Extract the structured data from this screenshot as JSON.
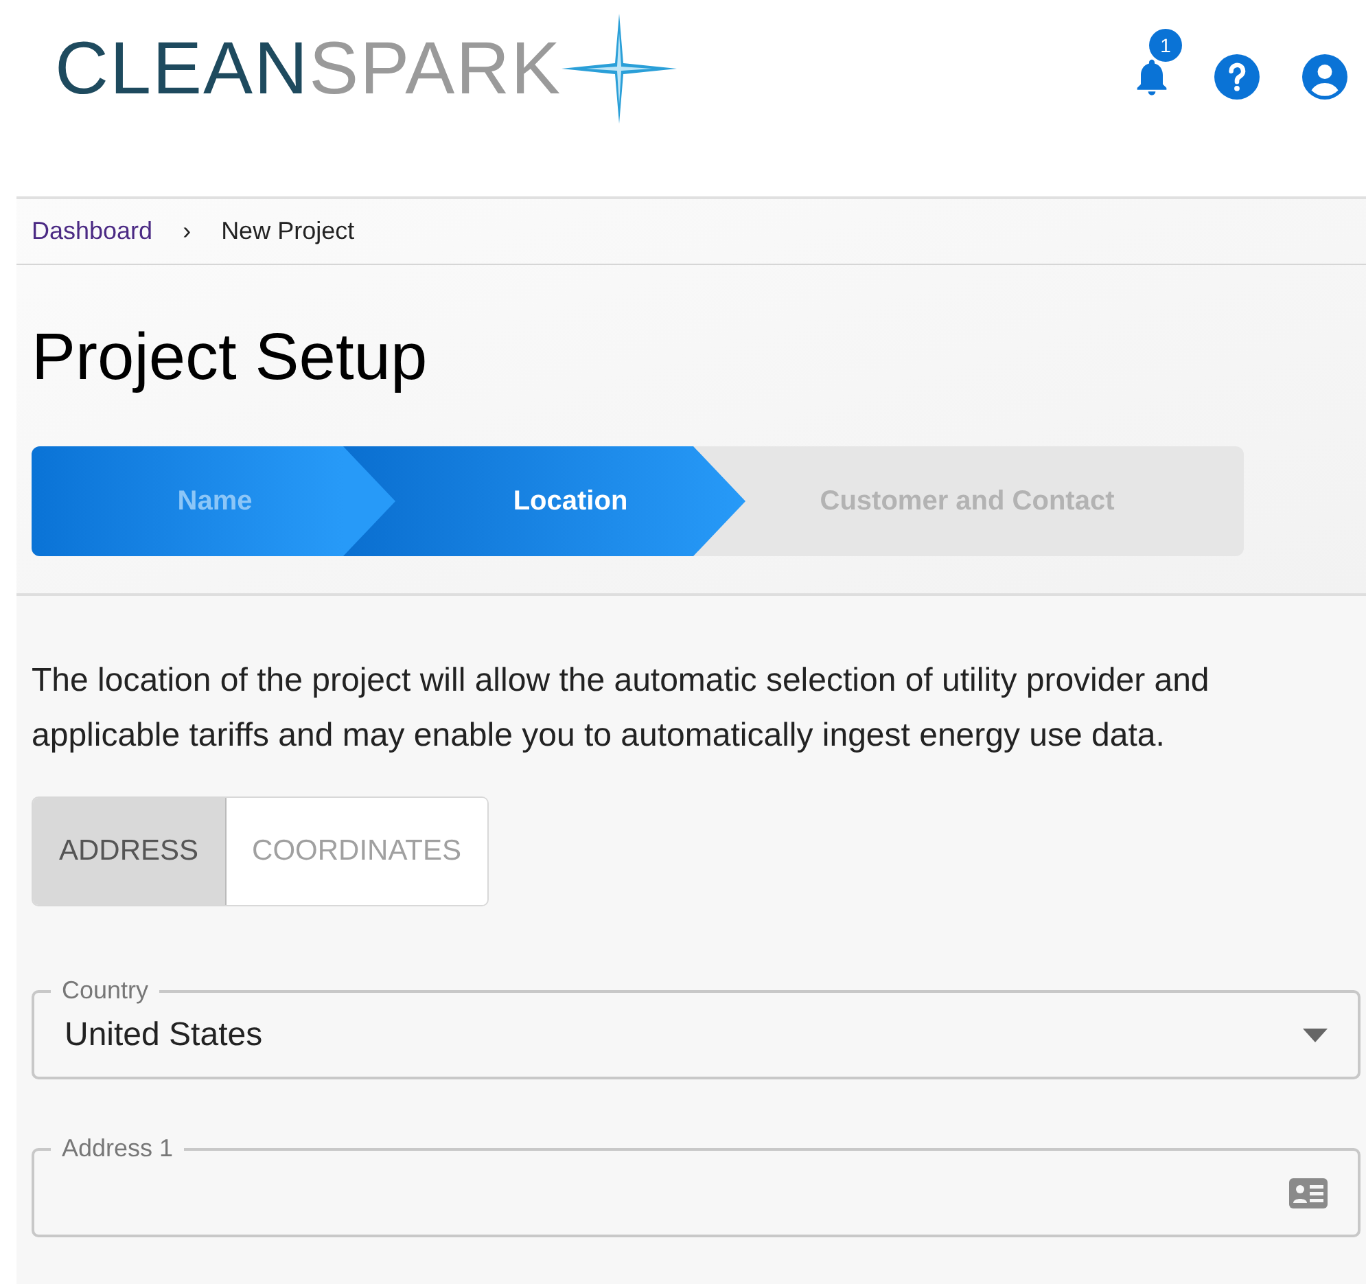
{
  "logo": {
    "part_1": "CLEAN",
    "part_2": "SPARK"
  },
  "header": {
    "notification_count": "1"
  },
  "breadcrumb": [
    {
      "label": "Dashboard",
      "kind": "link"
    },
    {
      "label": "›",
      "kind": "separator"
    },
    {
      "label": "New Project",
      "kind": "current"
    }
  ],
  "title": "Project Setup",
  "steps": [
    {
      "label": "Name",
      "selected": false,
      "completed": true
    },
    {
      "label": "Location",
      "selected": true,
      "completed": false
    },
    {
      "label": "Customer and Contact",
      "selected": false,
      "completed": false
    }
  ],
  "description": "The location of the project will allow the automatic selection of utility provider and applicable tariffs and may enable you to automatically ingest energy use data.",
  "location_modes": [
    {
      "label": "ADDRESS",
      "selected": true
    },
    {
      "label": "COORDINATES",
      "selected": false
    }
  ],
  "fields": [
    {
      "kind": "select",
      "label": "Country",
      "value": "United States"
    },
    {
      "kind": "text",
      "label": "Address 1"
    }
  ]
}
